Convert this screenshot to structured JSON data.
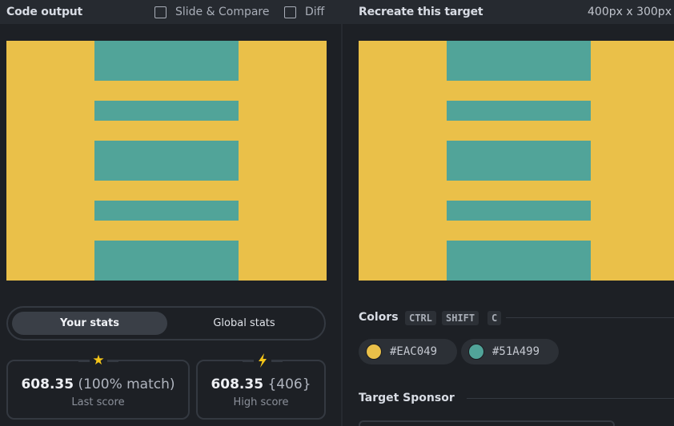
{
  "left_panel": {
    "title": "Code output",
    "slide_compare_label": "Slide & Compare",
    "diff_label": "Diff"
  },
  "right_panel": {
    "title": "Recreate this target",
    "dimensions": "400px x 300px"
  },
  "canvas": {
    "background": "#eac049",
    "bar_color": "#51a499"
  },
  "stats_tabs": {
    "active": "Your stats",
    "inactive": "Global stats"
  },
  "last_score": {
    "value": "608.35",
    "detail": "(100% match)",
    "label": "Last score",
    "icon": "star-icon"
  },
  "high_score": {
    "value": "608.35",
    "detail": "{406}",
    "label": "High score",
    "icon": "lightning-icon"
  },
  "colors_section": {
    "label": "Colors",
    "shortcut_keys": [
      "CTRL",
      "SHIFT",
      "C"
    ],
    "swatches": [
      {
        "hex": "#EAC049",
        "color": "#eac049"
      },
      {
        "hex": "#51A499",
        "color": "#51a499"
      }
    ]
  },
  "sponsor_section": {
    "label": "Target Sponsor"
  }
}
